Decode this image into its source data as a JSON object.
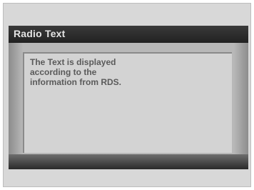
{
  "window": {
    "title": "Radio Text"
  },
  "content": {
    "message": "The Text is displayed\naccording to the\ninformation from RDS."
  }
}
